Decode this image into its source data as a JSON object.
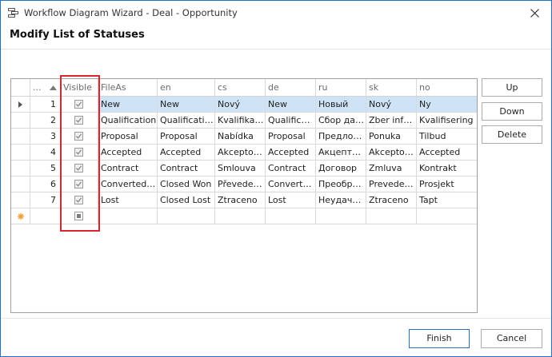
{
  "window": {
    "title": "Workflow Diagram Wizard - Deal - Opportunity",
    "icon": "workflow-window-icon",
    "close_icon": "close-icon"
  },
  "page": {
    "heading": "Modify List of Statuses"
  },
  "grid": {
    "columns": [
      {
        "key": "num",
        "label": "...",
        "sort": "ascending"
      },
      {
        "key": "visible",
        "label": "Visible"
      },
      {
        "key": "fileas",
        "label": "FileAs"
      },
      {
        "key": "en",
        "label": "en"
      },
      {
        "key": "cs",
        "label": "cs"
      },
      {
        "key": "de",
        "label": "de"
      },
      {
        "key": "ru",
        "label": "ru"
      },
      {
        "key": "sk",
        "label": "sk"
      },
      {
        "key": "no",
        "label": "no"
      }
    ],
    "rows": [
      {
        "num": "1",
        "visible": true,
        "fileas": "New",
        "en": "New",
        "cs": "Nový",
        "de": "New",
        "ru": "Новый",
        "sk": "Nový",
        "no": "Ny",
        "selected": true
      },
      {
        "num": "2",
        "visible": true,
        "fileas": "Qualification",
        "en": "Qualification",
        "cs": "Kvalifikace",
        "de": "Qualificati...",
        "ru": "Сбор дан...",
        "sk": "Zber infor...",
        "no": "Kvalifisering"
      },
      {
        "num": "3",
        "visible": true,
        "fileas": "Proposal",
        "en": "Proposal",
        "cs": "Nabídka",
        "de": "Proposal",
        "ru": "Предлож...",
        "sk": "Ponuka",
        "no": "Tilbud"
      },
      {
        "num": "4",
        "visible": true,
        "fileas": "Accepted",
        "en": "Accepted",
        "cs": "Akceptov...",
        "de": "Accepted",
        "ru": "Акцепто...",
        "sk": "Akceptov...",
        "no": "Accepted"
      },
      {
        "num": "5",
        "visible": true,
        "fileas": "Contract",
        "en": "Contract",
        "cs": "Smlouva",
        "de": "Contract",
        "ru": "Договор",
        "sk": "Zmluva",
        "no": "Kontrakt"
      },
      {
        "num": "6",
        "visible": true,
        "fileas": "Converted t...",
        "en": "Closed Won",
        "cs": "Převeden...",
        "de": "Converte...",
        "ru": "Преобраз...",
        "sk": "Preveden...",
        "no": "Prosjekt"
      },
      {
        "num": "7",
        "visible": true,
        "fileas": "Lost",
        "en": "Closed Lost",
        "cs": "Ztraceno",
        "de": "Lost",
        "ru": "Неудачн...",
        "sk": "Ztraceno",
        "no": "Tapt"
      }
    ],
    "new_row_icon": "new-row-asterisk-icon",
    "current_row_icon": "row-pointer-icon"
  },
  "side_buttons": {
    "up": "Up",
    "down": "Down",
    "delete": "Delete"
  },
  "footer": {
    "finish": "Finish",
    "cancel": "Cancel"
  },
  "colors": {
    "selected_row": "#cfe3f7",
    "highlight_box": "#d9262c",
    "window_border": "#1f6fc4",
    "new_row_marker": "#f0a030"
  }
}
